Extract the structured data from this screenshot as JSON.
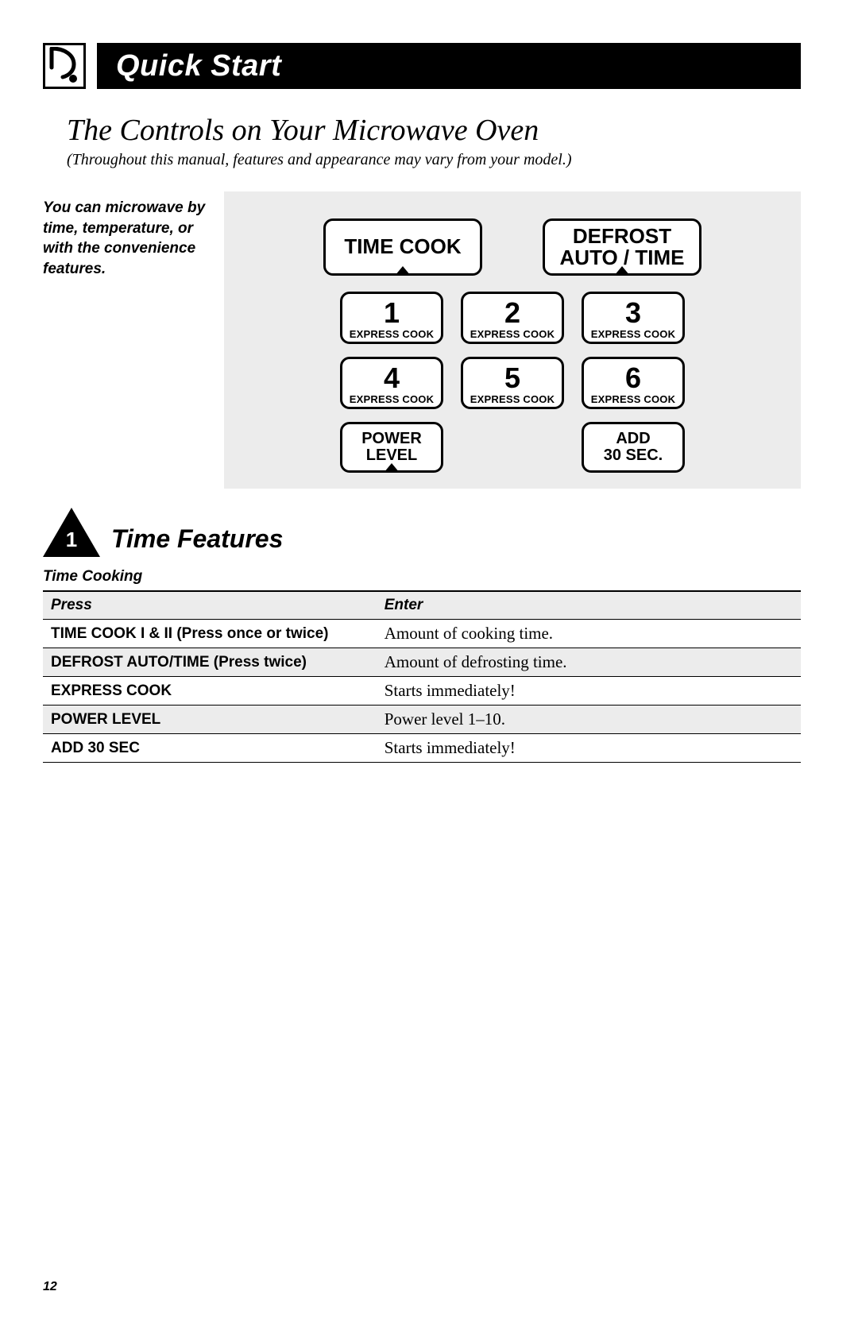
{
  "header": {
    "title": "Quick Start"
  },
  "title_block": {
    "title": "The Controls on Your Microwave Oven",
    "subtitle": "(Throughout this manual, features and appearance may vary from your model.)"
  },
  "side_note": "You can microwave by time, temperature, or with the convenience features.",
  "panel": {
    "top_buttons": [
      {
        "line1": "TIME COOK",
        "line2": ""
      },
      {
        "line1": "DEFROST",
        "line2": "AUTO / TIME"
      }
    ],
    "num_buttons": [
      {
        "digit": "1",
        "sub": "EXPRESS COOK"
      },
      {
        "digit": "2",
        "sub": "EXPRESS COOK"
      },
      {
        "digit": "3",
        "sub": "EXPRESS COOK"
      },
      {
        "digit": "4",
        "sub": "EXPRESS COOK"
      },
      {
        "digit": "5",
        "sub": "EXPRESS COOK"
      },
      {
        "digit": "6",
        "sub": "EXPRESS COOK"
      }
    ],
    "bottom_buttons": [
      {
        "line1": "POWER",
        "line2": "LEVEL"
      },
      {
        "line1": "ADD",
        "line2": "30 SEC."
      }
    ]
  },
  "section": {
    "number": "1",
    "title": "Time Features",
    "sub": "Time Cooking"
  },
  "table": {
    "headers": {
      "press": "Press",
      "enter": "Enter"
    },
    "rows": [
      {
        "press": "TIME COOK I & II (Press once or twice)",
        "enter": "Amount of cooking time."
      },
      {
        "press": "DEFROST AUTO/TIME (Press twice)",
        "enter": "Amount of defrosting time."
      },
      {
        "press": "EXPRESS COOK",
        "enter": "Starts immediately!"
      },
      {
        "press": "POWER LEVEL",
        "enter": "Power level 1–10."
      },
      {
        "press": "ADD 30 SEC",
        "enter": "Starts immediately!"
      }
    ]
  },
  "page_number": "12"
}
